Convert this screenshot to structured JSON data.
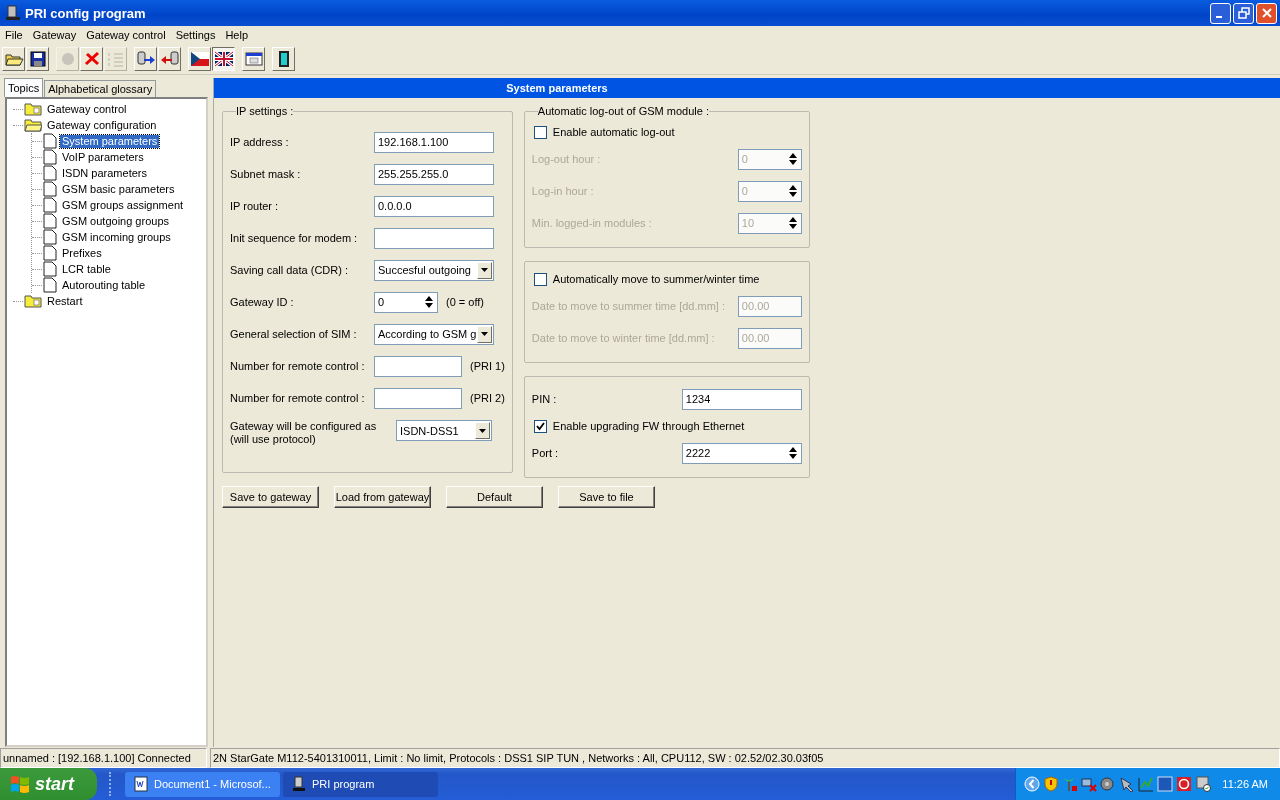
{
  "window": {
    "title": "PRI config program"
  },
  "menu": [
    "File",
    "Gateway",
    "Gateway control",
    "Settings",
    "Help"
  ],
  "toolbar": [
    {
      "kind": "open",
      "disabled": false,
      "pressed": false
    },
    {
      "kind": "save",
      "disabled": false,
      "pressed": false
    },
    {
      "kind": "gap"
    },
    {
      "kind": "stop",
      "disabled": true,
      "pressed": false
    },
    {
      "kind": "delete",
      "disabled": false,
      "pressed": false
    },
    {
      "kind": "list",
      "disabled": true,
      "pressed": false
    },
    {
      "kind": "gap"
    },
    {
      "kind": "upload",
      "disabled": false,
      "pressed": false
    },
    {
      "kind": "download",
      "disabled": false,
      "pressed": false
    },
    {
      "kind": "gap"
    },
    {
      "kind": "flag-cz",
      "disabled": false,
      "pressed": false
    },
    {
      "kind": "flag-uk",
      "disabled": false,
      "pressed": true
    },
    {
      "kind": "gap"
    },
    {
      "kind": "terminal",
      "disabled": false,
      "pressed": false
    },
    {
      "kind": "gap"
    },
    {
      "kind": "exit",
      "disabled": false,
      "pressed": false
    }
  ],
  "side_tabs": [
    {
      "label": "Topics",
      "selected": true
    },
    {
      "label": "Alphabetical glossary",
      "selected": false
    }
  ],
  "tree": [
    {
      "label": "Gateway control",
      "kind": "folder",
      "expanded": false,
      "selected": false
    },
    {
      "label": "Gateway configuration",
      "kind": "folder",
      "expanded": true,
      "selected": false,
      "children": [
        {
          "label": "System parameters",
          "kind": "page",
          "selected": true
        },
        {
          "label": "VoIP parameters",
          "kind": "page",
          "selected": false
        },
        {
          "label": "ISDN parameters",
          "kind": "page",
          "selected": false
        },
        {
          "label": "GSM basic parameters",
          "kind": "page",
          "selected": false
        },
        {
          "label": "GSM groups assignment",
          "kind": "page",
          "selected": false
        },
        {
          "label": "GSM outgoing groups",
          "kind": "page",
          "selected": false
        },
        {
          "label": "GSM incoming groups",
          "kind": "page",
          "selected": false
        },
        {
          "label": "Prefixes",
          "kind": "page",
          "selected": false
        },
        {
          "label": "LCR table",
          "kind": "page",
          "selected": false
        },
        {
          "label": "Autorouting table",
          "kind": "page",
          "selected": false
        }
      ]
    },
    {
      "label": "Restart",
      "kind": "folder",
      "expanded": false,
      "selected": false
    }
  ],
  "panel_title": "System parameters",
  "ip_settings": {
    "title": "IP settings :",
    "rows": [
      {
        "kind": "text",
        "label": "IP address :",
        "value": "192.168.1.100"
      },
      {
        "kind": "text",
        "label": "Subnet mask :",
        "value": "255.255.255.0"
      },
      {
        "kind": "text",
        "label": "IP router :",
        "value": "0.0.0.0"
      },
      {
        "kind": "text",
        "label": "Init sequence for modem :"
      },
      {
        "kind": "combo",
        "label": "Saving call data (CDR) :",
        "value": "Succesful outgoing"
      },
      {
        "kind": "spin",
        "label": "Gateway ID :",
        "value": "0",
        "note": "(0 = off)"
      },
      {
        "kind": "combo",
        "label": "General selection of SIM :",
        "value": "According to GSM g"
      },
      {
        "kind": "short",
        "label": "Number for remote control :",
        "note": "(PRI 1)"
      },
      {
        "kind": "short",
        "label": "Number for remote control :",
        "note": "(PRI 2)"
      },
      {
        "kind": "protocol",
        "label": "Gateway will be configured as (will use protocol)",
        "value": "ISDN-DSS1"
      }
    ]
  },
  "right_groups": [
    {
      "title": "Automatic log-out of GSM module :",
      "items": [
        {
          "kind": "checkbox",
          "label": "Enable automatic log-out",
          "checked": false
        },
        {
          "kind": "spin",
          "label": "Log-out hour :",
          "value": "0",
          "disabled": true
        },
        {
          "kind": "spin",
          "label": "Log-in hour :",
          "value": "0",
          "disabled": true
        },
        {
          "kind": "spin",
          "label": "Min. logged-in modules :",
          "value": "10",
          "disabled": true
        }
      ]
    },
    {
      "items": [
        {
          "kind": "checkbox",
          "label": "Automatically move to summer/winter time",
          "checked": false
        },
        {
          "kind": "date",
          "label": "Date to move to summer time [dd.mm] :",
          "value": "00.00",
          "disabled": true
        },
        {
          "kind": "date",
          "label": "Date to move to winter time [dd.mm] :",
          "value": "00.00",
          "disabled": true
        }
      ]
    },
    {
      "items": [
        {
          "kind": "text",
          "label": "PIN :",
          "value": "1234",
          "disabled": false
        },
        {
          "kind": "checkbox",
          "label": "Enable upgrading FW through Ethernet",
          "checked": true
        },
        {
          "kind": "spin",
          "label": "Port :",
          "value": "2222",
          "disabled": false
        }
      ]
    }
  ],
  "buttons": [
    "Save to gateway",
    "Load from gateway",
    "Default",
    "Save to file"
  ],
  "status_bar": [
    "unnamed : [192.168.1.100] Connected",
    "2N StarGate M112-5401310011, Limit : No limit, Protocols : DSS1 SIP TUN , Networks : All, CPU112, SW : 02.52/02.30.03f05"
  ],
  "taskbar": {
    "start": "start",
    "tasks": [
      {
        "label": "Document1 - Microsof...",
        "kind": "word",
        "selected": false
      },
      {
        "label": "PRI program",
        "kind": "app",
        "selected": true
      }
    ],
    "clock": "11:26 AM"
  }
}
